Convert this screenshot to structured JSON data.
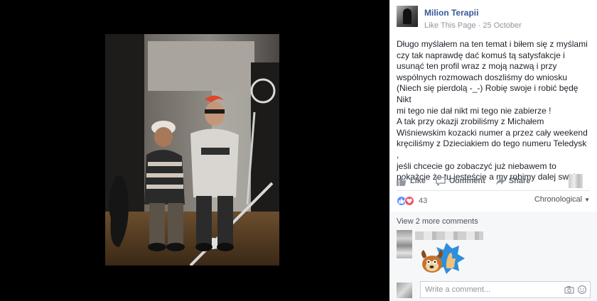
{
  "post": {
    "page_name": "Milion Terapii",
    "like_this_page": "Like This Page",
    "separator": "·",
    "date": "25 October",
    "text_lines": [
      "Długo myślałem na ten temat i biłem się z myślami",
      "czy tak naprawdę dać komuś tą satysfakcje i",
      "usunąć ten profil wraz z moją nazwą i przy",
      "wspólnych rozmowach doszliśmy do wniosku",
      "(Niech się pierdolą -_-) Robię swoje i robić będę Nikt",
      "mi tego nie dał nikt mi tego nie zabierze !",
      "A tak przy okazji zrobiliśmy z Michałem",
      "Wiśniewskim kozacki numer a przez cały weekend",
      "kręciliśmy z Dzieciakiem do tego numeru Teledysk ,",
      "jeśli chcecie go zobaczyć już niebawem to",
      "pokażcie że tu jesteście a my robimy dalej swoje"
    ]
  },
  "actions": {
    "like": "Like",
    "comment": "Comment",
    "share": "Share"
  },
  "reactions": {
    "count": "43",
    "sort_label": "Chronological"
  },
  "comments": {
    "view_more": "View 2 more comments",
    "input_placeholder": "Write a comment..."
  },
  "colors": {
    "link_blue": "#365899",
    "like_blue": "#5890ff",
    "love_red": "#f25268",
    "comment_bg": "#f6f7f9"
  },
  "icons": [
    "thumbs-up-icon",
    "comment-icon",
    "share-icon",
    "love-icon",
    "chevron-down-icon",
    "camera-icon",
    "sticker-icon"
  ]
}
